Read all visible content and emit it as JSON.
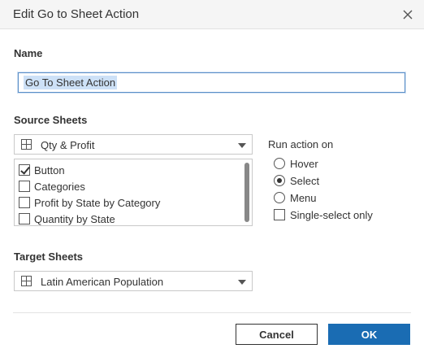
{
  "dialog": {
    "title": "Edit Go to Sheet Action"
  },
  "name_section": {
    "label": "Name",
    "value": "Go To Sheet Action"
  },
  "source_sheets": {
    "label": "Source Sheets",
    "selected_dashboard": "Qty & Profit",
    "dropdown_icon": "dashboard-grid-icon",
    "items": [
      {
        "label": "Button",
        "checked": true
      },
      {
        "label": "Categories",
        "checked": false
      },
      {
        "label": "Profit by State by Category",
        "checked": false
      },
      {
        "label": "Quantity by State",
        "checked": false
      }
    ]
  },
  "run_action": {
    "label": "Run action on",
    "options": [
      {
        "label": "Hover",
        "selected": false
      },
      {
        "label": "Select",
        "selected": true
      },
      {
        "label": "Menu",
        "selected": false
      }
    ],
    "single_select_label": "Single-select only",
    "single_select_checked": false
  },
  "target_sheets": {
    "label": "Target Sheets",
    "selected": "Latin American Population",
    "dropdown_icon": "dashboard-grid-icon"
  },
  "footer": {
    "cancel_label": "Cancel",
    "ok_label": "OK"
  },
  "colors": {
    "accent": "#1a6cb3",
    "focus_border": "#5b8fc7",
    "selection_highlight": "#cde1f7"
  }
}
